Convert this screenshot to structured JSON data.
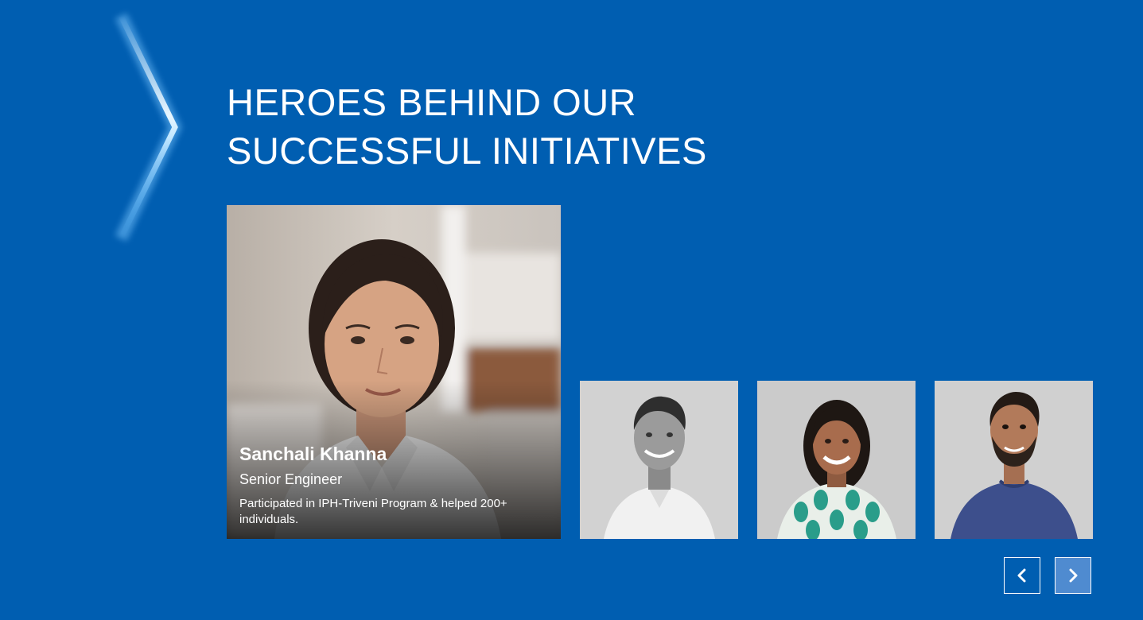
{
  "section": {
    "title_lines": [
      "HEROES BEHIND OUR",
      "SUCCESSFUL INITIATIVES"
    ]
  },
  "featured": {
    "name": "Sanchali Khanna",
    "role": "Senior Engineer",
    "description": "Participated in IPH-Triveni Program & helped 200+ individuals."
  },
  "thumbnails": [
    {
      "icon": "person-portrait-man-smiling"
    },
    {
      "icon": "person-portrait-woman-smiling"
    },
    {
      "icon": "person-portrait-man-bearded"
    }
  ],
  "navigation": {
    "prev_icon": "chevron-left-icon",
    "next_icon": "chevron-right-icon"
  },
  "colors": {
    "background": "#005eb1",
    "text": "#ffffff",
    "next_button_fill": "#4f8bd0"
  }
}
